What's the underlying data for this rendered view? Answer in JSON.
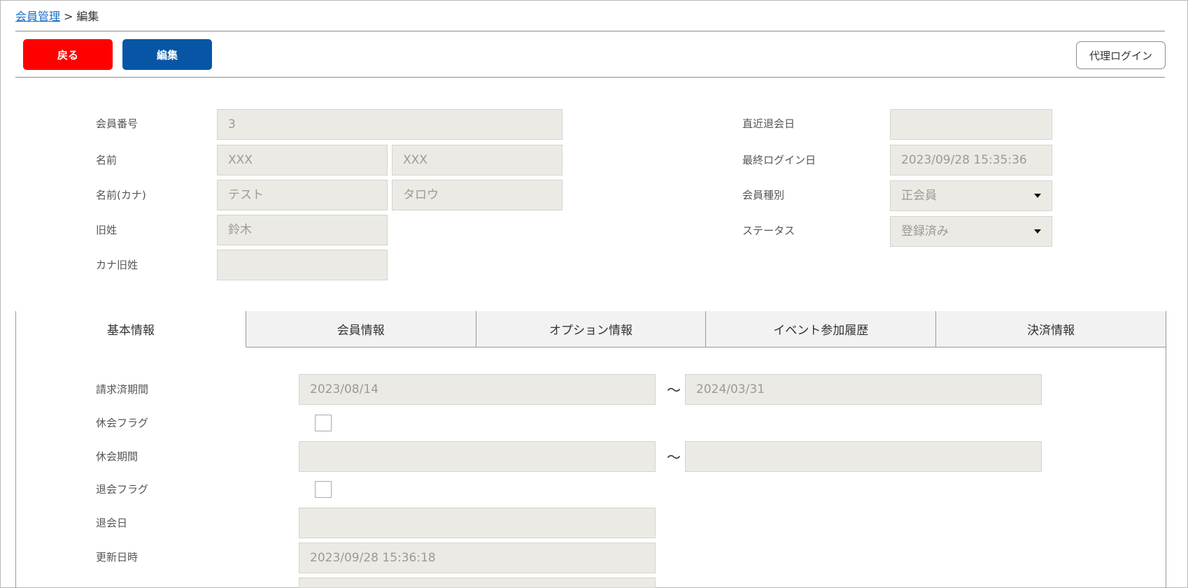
{
  "breadcrumb": {
    "parent": "会員管理",
    "separator": ">",
    "current": "編集"
  },
  "toolbar": {
    "back_label": "戻る",
    "edit_label": "編集",
    "proxy_login_label": "代理ログイン"
  },
  "colors": {
    "back_button": "#ff0000",
    "edit_button": "#0656a5",
    "field_bg": "#ebeae4",
    "link": "#1a6fc9"
  },
  "profile": {
    "member_number": {
      "label": "会員番号",
      "value": "3"
    },
    "name": {
      "label": "名前",
      "last": "XXX",
      "first": "XXX"
    },
    "name_kana": {
      "label": "名前(カナ)",
      "last": "テスト",
      "first": "タロウ"
    },
    "former_surname": {
      "label": "旧姓",
      "value": "鈴木"
    },
    "former_surname_kana": {
      "label": "カナ旧姓",
      "value": ""
    },
    "latest_withdrawal_date": {
      "label": "直近退会日",
      "value": ""
    },
    "last_login_date": {
      "label": "最終ログイン日",
      "value": "2023/09/28 15:35:36"
    },
    "member_type": {
      "label": "会員種別",
      "value": "正会員"
    },
    "status": {
      "label": "ステータス",
      "value": "登録済み"
    }
  },
  "tabs": [
    {
      "label": "基本情報",
      "active": true
    },
    {
      "label": "会員情報",
      "active": false
    },
    {
      "label": "オプション情報",
      "active": false
    },
    {
      "label": "イベント参加履歴",
      "active": false
    },
    {
      "label": "決済情報",
      "active": false
    }
  ],
  "basic_info": {
    "billed_period": {
      "label": "請求済期間",
      "from": "2023/08/14",
      "to": "2024/03/31"
    },
    "suspension_flag": {
      "label": "休会フラグ",
      "checked": false
    },
    "suspension_period": {
      "label": "休会期間",
      "from": "",
      "to": ""
    },
    "withdrawal_flag": {
      "label": "退会フラグ",
      "checked": false
    },
    "withdrawal_date": {
      "label": "退会日",
      "value": ""
    },
    "updated_at": {
      "label": "更新日時",
      "value": "2023/09/28 15:36:18"
    },
    "range_separator": "～"
  }
}
